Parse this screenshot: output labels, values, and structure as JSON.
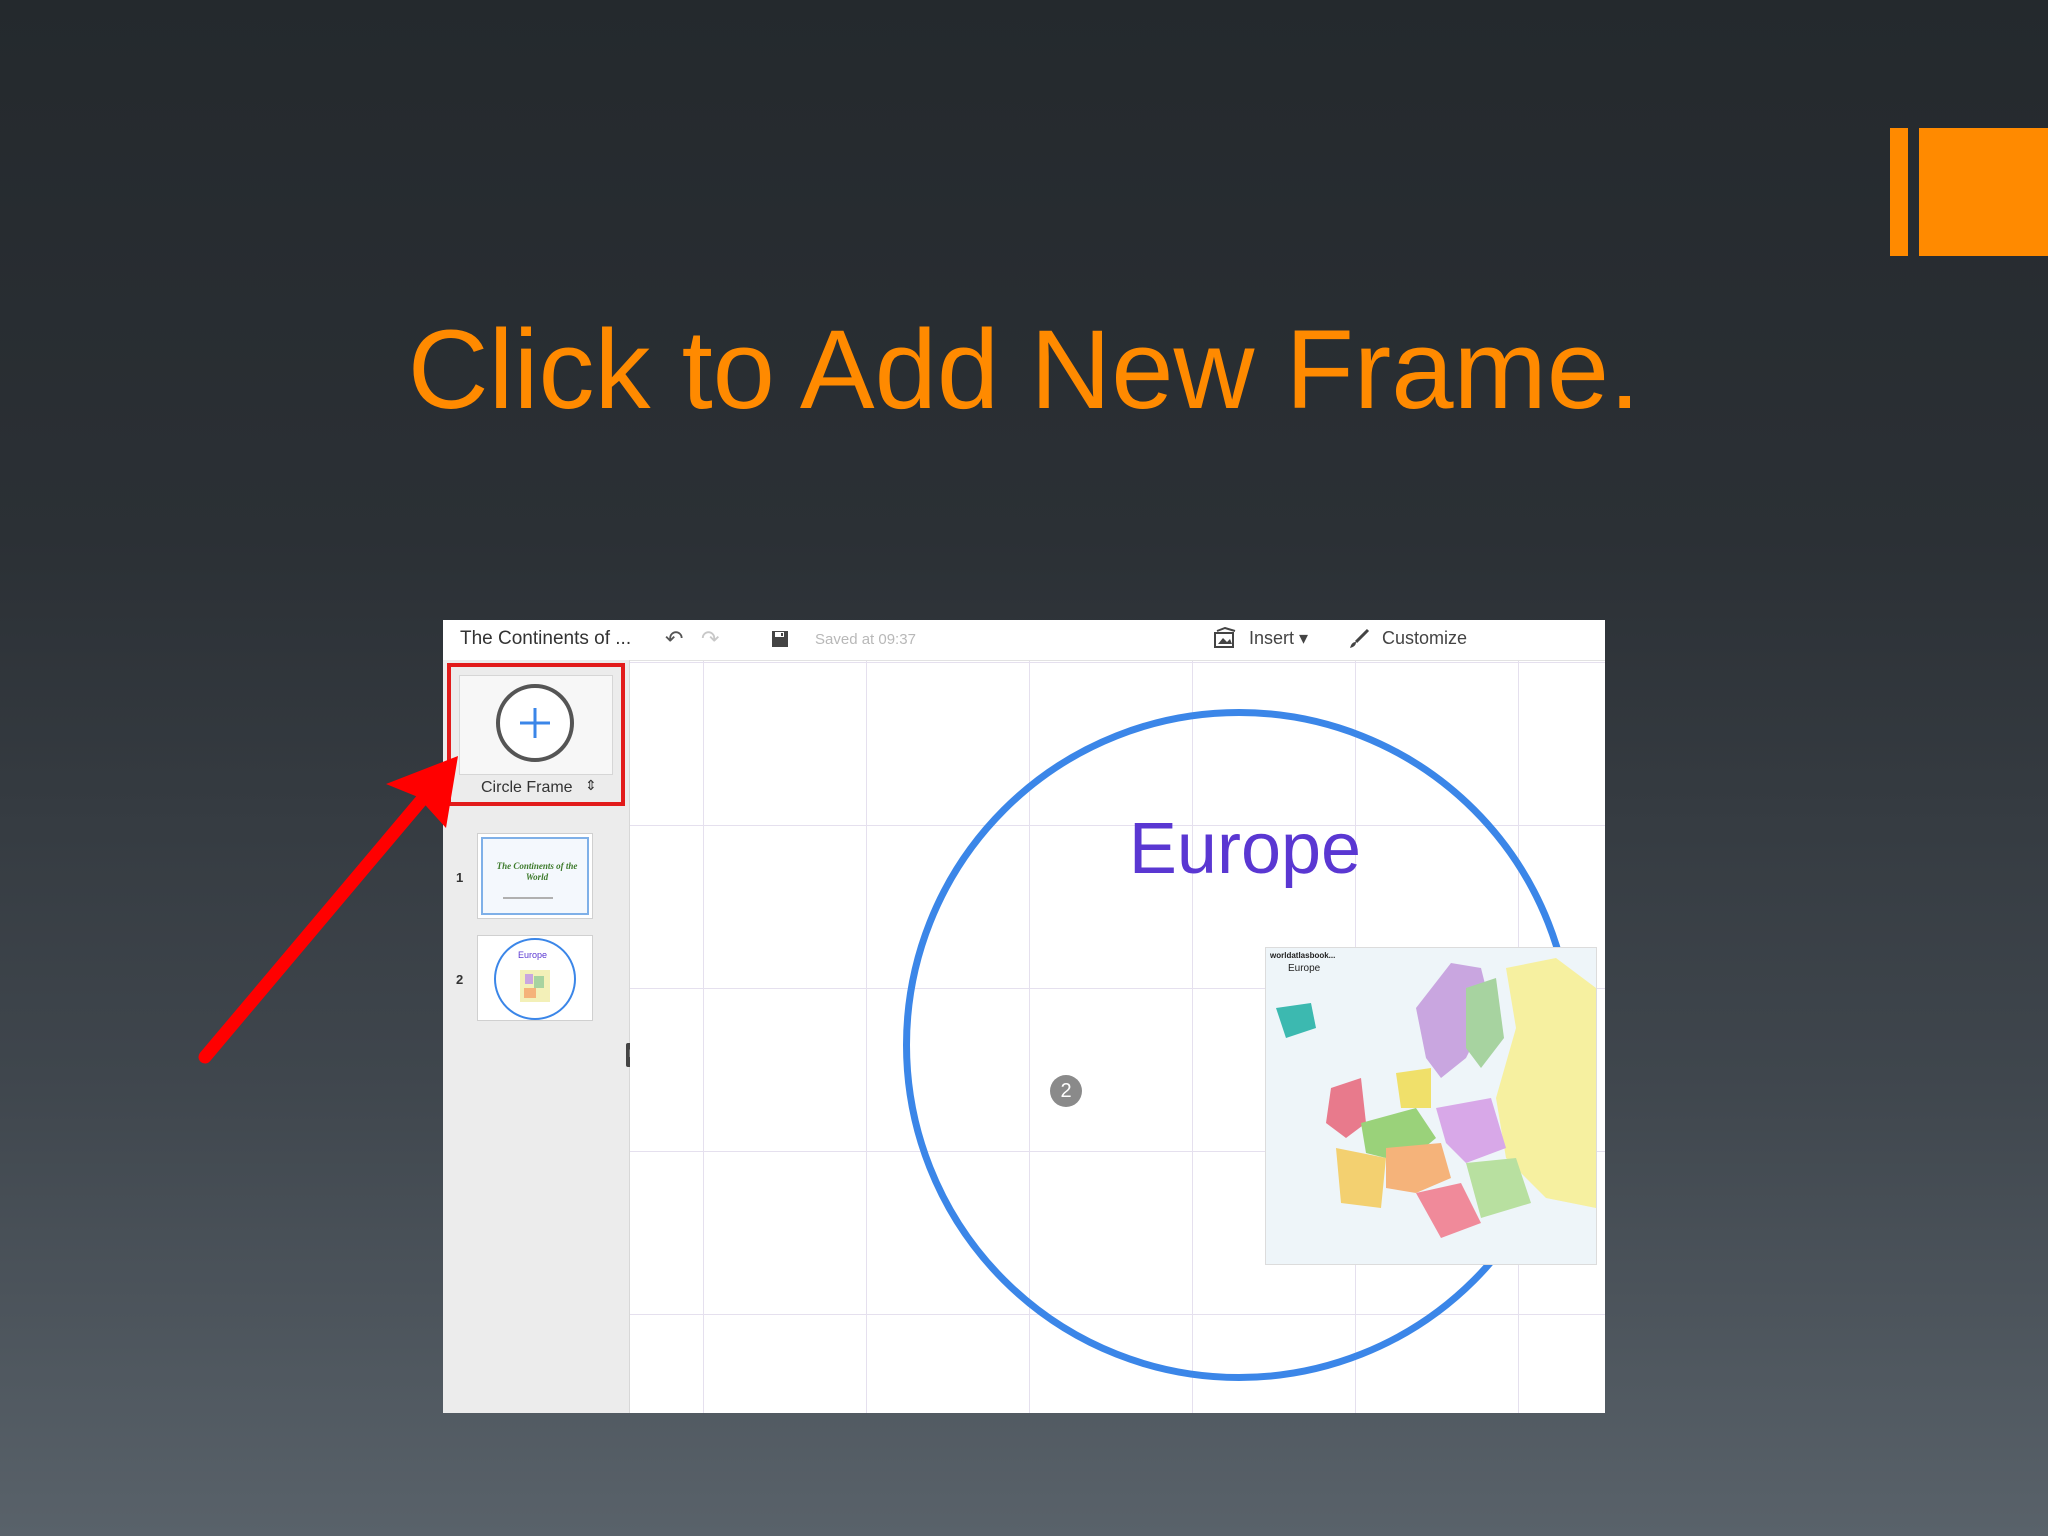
{
  "slide": {
    "title": "Click to Add New Frame.",
    "title_color": "#ff8a00",
    "accent_color": "#ff8a00"
  },
  "app": {
    "presentation_title": "The Continents of ...",
    "saved_status": "Saved at 09:37",
    "insert_label": "Insert",
    "customize_label": "Customize",
    "icons": [
      "undo-icon",
      "redo-icon",
      "save-icon",
      "insert-icon",
      "customize-brush-icon"
    ]
  },
  "sidebar": {
    "frame_type_label": "Circle Frame",
    "thumbnails": [
      {
        "number": "1",
        "title": "The Continents of the World"
      },
      {
        "number": "2",
        "title": "Europe"
      }
    ]
  },
  "canvas": {
    "frame_number": "2",
    "frame_title": "Europe",
    "frame_color": "#3b86e8",
    "title_color": "#5a37d2",
    "map_sub": "Europe"
  },
  "highlight": {
    "box_color": "#e21b1b",
    "arrow_color": "#ff0000"
  }
}
